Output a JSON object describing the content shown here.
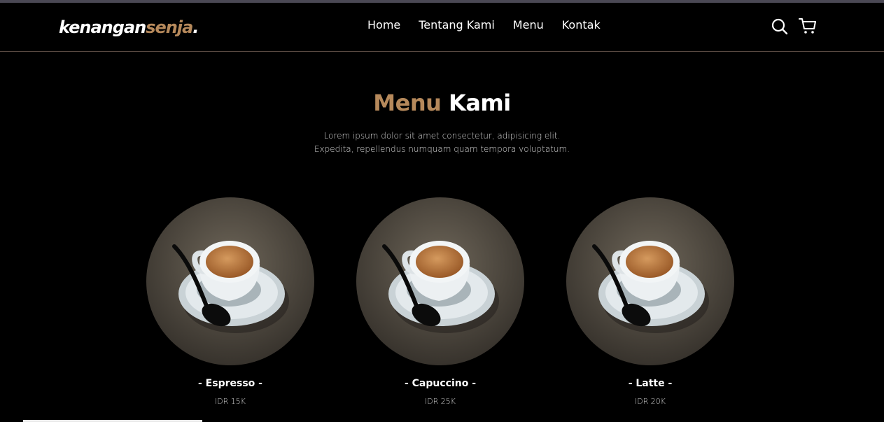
{
  "brand": {
    "part1": "kenangan",
    "part2": "senja",
    "part3": "."
  },
  "nav": {
    "items": [
      {
        "label": "Home"
      },
      {
        "label": "Tentang Kami"
      },
      {
        "label": "Menu"
      },
      {
        "label": "Kontak"
      }
    ],
    "icons": [
      "search-icon",
      "shopping-cart-icon"
    ]
  },
  "menu": {
    "title_accent": "Menu",
    "title_rest": "Kami",
    "desc_line1": "Lorem ipsum dolor sit amet consectetur, adipisicing elit.",
    "desc_line2": "Expedita, repellendus numquam quam tempora voluptatum.",
    "items": [
      {
        "name": "- Espresso -",
        "price": "IDR 15K"
      },
      {
        "name": "- Capuccino -",
        "price": "IDR 25K"
      },
      {
        "name": "- Latte -",
        "price": "IDR 20K"
      }
    ]
  },
  "colors": {
    "accent": "#b6895b",
    "background": "#000000",
    "text": "#ffffff"
  }
}
